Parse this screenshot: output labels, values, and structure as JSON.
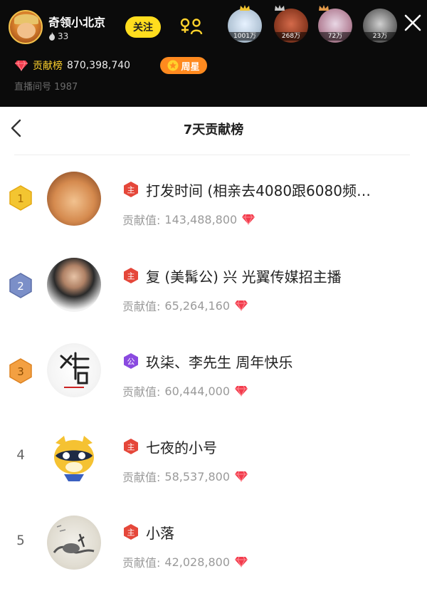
{
  "header": {
    "host_name": "奇领小北京",
    "host_fans": "33",
    "follow_label": "关注",
    "contrib_label": "贡献榜",
    "contrib_value": "870,398,740",
    "week_star_label": "周星",
    "room_label": "直播间号",
    "room_number": "1987",
    "viewers": [
      {
        "label": "1001万"
      },
      {
        "label": "268万"
      },
      {
        "label": "72万"
      },
      {
        "label": "23万"
      }
    ]
  },
  "sheet": {
    "title": "7天贡献榜",
    "value_prefix": "贡献值:",
    "entries": [
      {
        "rank": "1",
        "name": "打发时间 (相亲去4080跟6080频…",
        "value": "143,488,800",
        "level_badge": "主"
      },
      {
        "rank": "2",
        "name": "复 (美髯公) 兴 光翼传媒招主播",
        "value": "65,264,160",
        "level_badge": "主"
      },
      {
        "rank": "3",
        "name": "玖柒、李先生 周年快乐",
        "value": "60,444,000",
        "level_badge": "公"
      },
      {
        "rank": "4",
        "name": "七夜的小号",
        "value": "58,537,800",
        "level_badge": "主"
      },
      {
        "rank": "5",
        "name": "小落",
        "value": "42,028,800",
        "level_badge": "主"
      }
    ]
  },
  "colors": {
    "header_bg": "#0b0b0b",
    "follow_yellow": "#ffdd1e",
    "week_star_orange": "#ff8a1f",
    "gem_red": "#f23b4c",
    "rank1_gold": "#f3c531",
    "rank2_blue": "#7b8fc8",
    "rank3_orange": "#f3a042"
  },
  "icons": [
    "fire-icon",
    "link-icon",
    "close-icon",
    "gem-icon",
    "star-icon",
    "back-icon",
    "rank-badge-icon",
    "level-badge-icon",
    "crown-icon"
  ]
}
